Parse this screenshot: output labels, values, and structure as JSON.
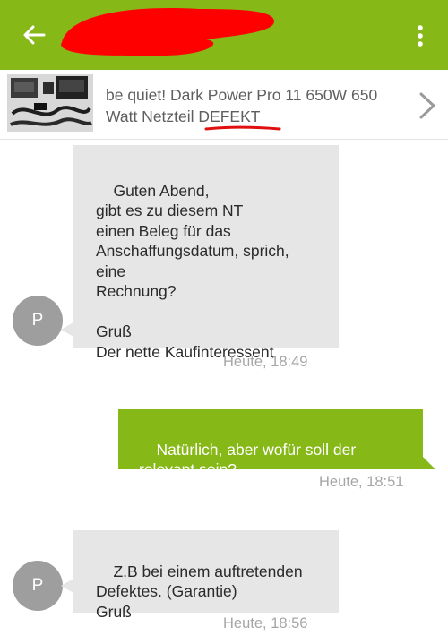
{
  "header": {
    "back_icon": "back-arrow-icon",
    "menu_icon": "more-vert-icon",
    "title_redacted": true,
    "colors": {
      "bar": "#86b817",
      "redaction": "#ff0000"
    }
  },
  "listing": {
    "title_prefix": "be quiet! Dark Power Pro 11 650W 650 Watt Netzteil ",
    "title_highlight": "DEFEKT",
    "chevron_icon": "chevron-right-icon"
  },
  "messages": [
    {
      "direction": "incoming",
      "avatar_letter": "P",
      "text": "Guten Abend,\ngibt es zu diesem NT\neinen Beleg für das\nAnschaffungsdatum, sprich,\neine\nRechnung?\n\nGruß\nDer nette Kaufinteressent",
      "time": "Heute, 18:49"
    },
    {
      "direction": "outgoing",
      "text": "Natürlich, aber wofür soll der\nrelevant sein?",
      "time": "Heute, 18:51"
    },
    {
      "direction": "incoming",
      "avatar_letter": "P",
      "text": "Z.B bei einem auftretenden\nDefektes. (Garantie)\nGruß",
      "time": "Heute, 18:56"
    }
  ],
  "colors": {
    "incoming_bubble": "#e6e6e6",
    "outgoing_bubble": "#86b817",
    "avatar": "#9e9e9e",
    "timestamp": "#a6a6a6"
  }
}
